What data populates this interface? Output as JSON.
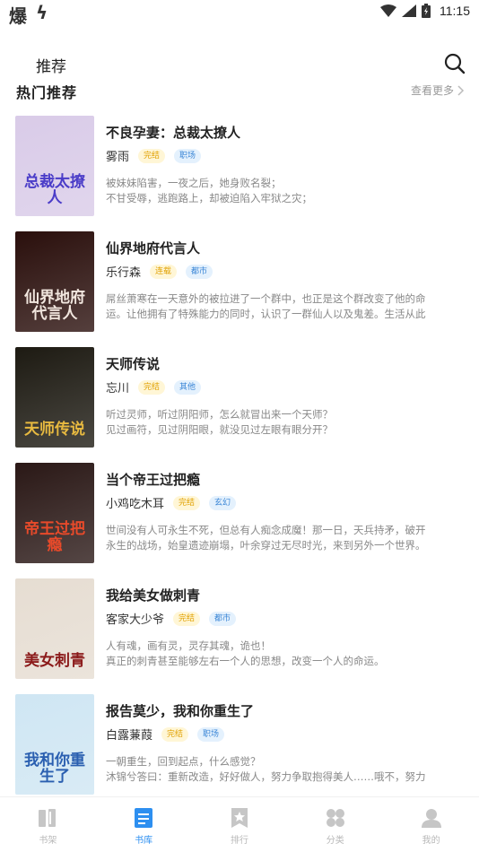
{
  "status_bar": {
    "left_glyphs": [
      "爆",
      "ϟ"
    ],
    "time": "11:15"
  },
  "header": {
    "title": "推荐"
  },
  "section": {
    "title": "热门推荐",
    "see_more": "查看更多"
  },
  "books": [
    {
      "title": "不良孕妻：总裁太撩人",
      "author": "雾雨",
      "status": "完结",
      "genre": "职场",
      "desc_line1": "被妹妹陷害，一夜之后，她身败名裂；",
      "desc_line2": "不甘受辱，逃跑路上，却被迫陷入牢狱之灾；",
      "cover_text": "总裁太撩人",
      "cover_bg": "#d9cbe8",
      "cover_text_color": "#4a3cc8"
    },
    {
      "title": "仙界地府代言人",
      "author": "乐行森",
      "status": "连载",
      "genre": "都市",
      "desc_line1": "屌丝萧寒在一天意外的被拉进了一个群中，也正是这个群改变了他的命",
      "desc_line2": "运。让他拥有了特殊能力的同时，认识了一群仙人以及鬼差。生活从此",
      "cover_text": "仙界地府代言人",
      "cover_bg": "#2a0f0c",
      "cover_text_color": "#f1e6de"
    },
    {
      "title": "天师传说",
      "author": "忘川",
      "status": "完结",
      "genre": "其他",
      "desc_line1": "听过灵师，听过阴阳师，怎么就冒出来一个天师？",
      "desc_line2": "见过画符，见过阴阳眼，就没见过左眼有眼分开？",
      "cover_text": "天师传说",
      "cover_bg": "#1d1a12",
      "cover_text_color": "#e7b940"
    },
    {
      "title": "当个帝王过把瘾",
      "author": "小鸡吃木耳",
      "status": "完结",
      "genre": "玄幻",
      "desc_line1": "世间没有人可永生不死，但总有人痴念成魔！那一日，天兵持矛，破开",
      "desc_line2": "永生的战场，始皇遗迹崩塌，叶余穿过无尽时光，来到另外一个世界。",
      "cover_text": "帝王过把瘾",
      "cover_bg": "#2a1816",
      "cover_text_color": "#e84a2a"
    },
    {
      "title": "我给美女做刺青",
      "author": "客家大少爷",
      "status": "完结",
      "genre": "都市",
      "desc_line1": "人有魂，画有灵，灵存其魂，诡也！",
      "desc_line2": "真正的刺青甚至能够左右一个人的思想，改变一个人的命运。",
      "cover_text": "美女刺青",
      "cover_bg": "#e6ddd2",
      "cover_text_color": "#8b1a1a"
    },
    {
      "title": "报告莫少，我和你重生了",
      "author": "白露蒹葭",
      "status": "完结",
      "genre": "职场",
      "desc_line1": "一朝重生，回到起点，什么感觉？",
      "desc_line2": "沐锦兮答曰：重新改造，好好做人，努力争取抱得美人……哦不，努力",
      "cover_text": "我和你重生了",
      "cover_bg": "#cfe6f3",
      "cover_text_color": "#2a5fb0"
    }
  ],
  "tabs": [
    {
      "label": "书架",
      "icon": "bookshelf-icon"
    },
    {
      "label": "书库",
      "icon": "library-icon"
    },
    {
      "label": "排行",
      "icon": "ranking-icon"
    },
    {
      "label": "分类",
      "icon": "category-icon"
    },
    {
      "label": "我的",
      "icon": "profile-icon"
    }
  ],
  "colors": {
    "accent": "#2d8ff0",
    "inactive": "#c6c6c6",
    "status_tag": "#e0a000",
    "genre_tag": "#3b86d6"
  }
}
